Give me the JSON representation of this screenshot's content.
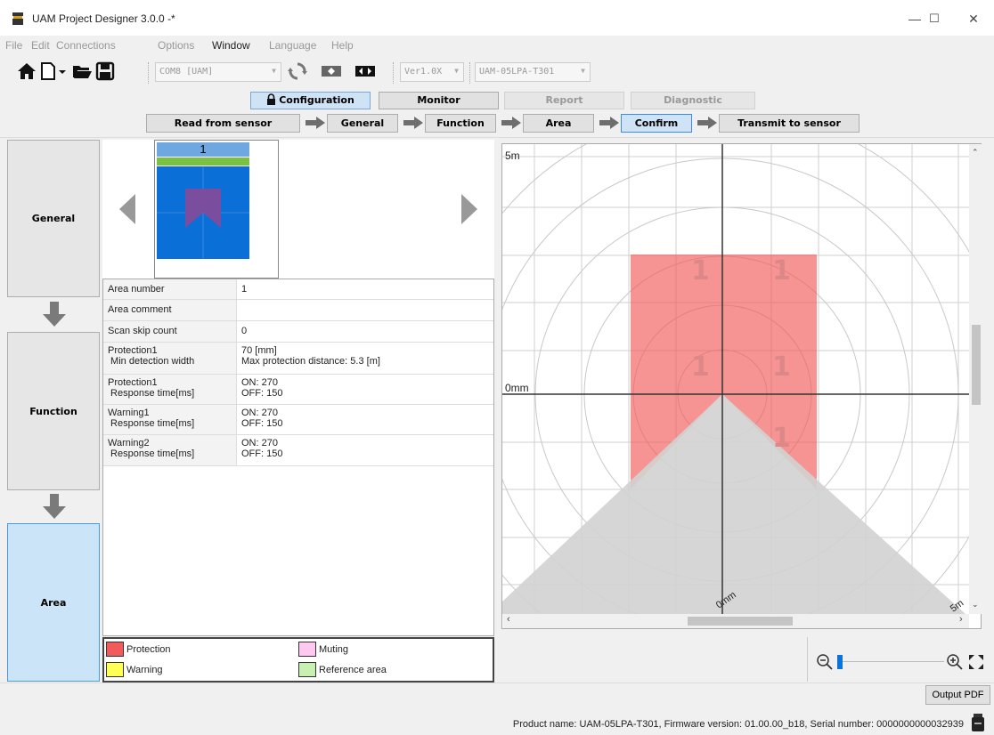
{
  "window": {
    "title": "UAM Project Designer 3.0.0 -*",
    "min": "—",
    "max": "☐",
    "close": "✕"
  },
  "menu": [
    "File",
    "Edit",
    "Connections",
    "Options",
    "Window",
    "Language",
    "Help"
  ],
  "toolbar": {
    "com_port": "COM8 [UAM]",
    "version": "Ver1.0X",
    "model": "UAM-05LPA-T301"
  },
  "modes": {
    "configuration": "Configuration",
    "monitor": "Monitor",
    "report": "Report",
    "diagnostic": "Diagnostic"
  },
  "steps": {
    "read": "Read from sensor",
    "general": "General",
    "function": "Function",
    "area": "Area",
    "confirm": "Confirm",
    "transmit": "Transmit to sensor"
  },
  "side": {
    "general": "General",
    "function": "Function",
    "area": "Area"
  },
  "thumbnail": {
    "number": "1"
  },
  "properties": [
    {
      "key": "Area number",
      "key2": "",
      "val": "1",
      "val2": ""
    },
    {
      "key": "Area comment",
      "key2": "",
      "val": "",
      "val2": ""
    },
    {
      "key": "Scan skip count",
      "key2": "",
      "val": "0",
      "val2": ""
    },
    {
      "key": "Protection1",
      "key2": " Min detection width",
      "val": "70 [mm]",
      "val2": "Max protection distance: 5.3 [m]"
    },
    {
      "key": "Protection1",
      "key2": " Response time[ms]",
      "val": "ON: 270",
      "val2": "OFF: 150"
    },
    {
      "key": "Warning1",
      "key2": " Response time[ms]",
      "val": "ON: 270",
      "val2": "OFF: 150"
    },
    {
      "key": "Warning2",
      "key2": " Response time[ms]",
      "val": "ON: 270",
      "val2": "OFF: 150"
    }
  ],
  "legend": {
    "protection": "Protection",
    "warning": "Warning",
    "muting": "Muting",
    "reference": "Reference area",
    "colors": {
      "protection": "#f15b5b",
      "warning": "#ffff55",
      "muting": "#ffc8f0",
      "reference": "#c8f0b0"
    }
  },
  "plot": {
    "top_label": "5m",
    "mid_label": "0mm",
    "bottom_label": "0mm",
    "right_label": "5m",
    "area_mark": "1"
  },
  "output_pdf": "Output PDF",
  "status": "Product name: UAM-05LPA-T301, Firmware version: 01.00.00_b18, Serial number: 0000000000032939"
}
